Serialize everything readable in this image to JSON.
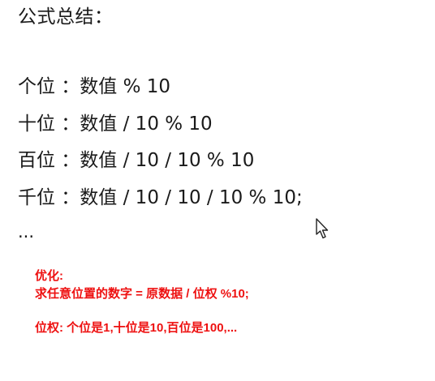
{
  "heading": "公式总结：",
  "formulas": [
    "个位 ：数值 % 10",
    "十位 ：数值 / 10 % 10",
    "百位 ：数值 / 10 / 10 % 10",
    "千位 ：数值 / 10 / 10 / 10 % 10;"
  ],
  "ellipsis": "...",
  "cursor_icon": "mouse-pointer-arrow",
  "highlight": {
    "color": "#ee1111",
    "title": "优化:",
    "formula": "求任意位置的数字 = 原数据 / 位权 %10;",
    "weights": "位权: 个位是1,十位是10,百位是100,..."
  }
}
